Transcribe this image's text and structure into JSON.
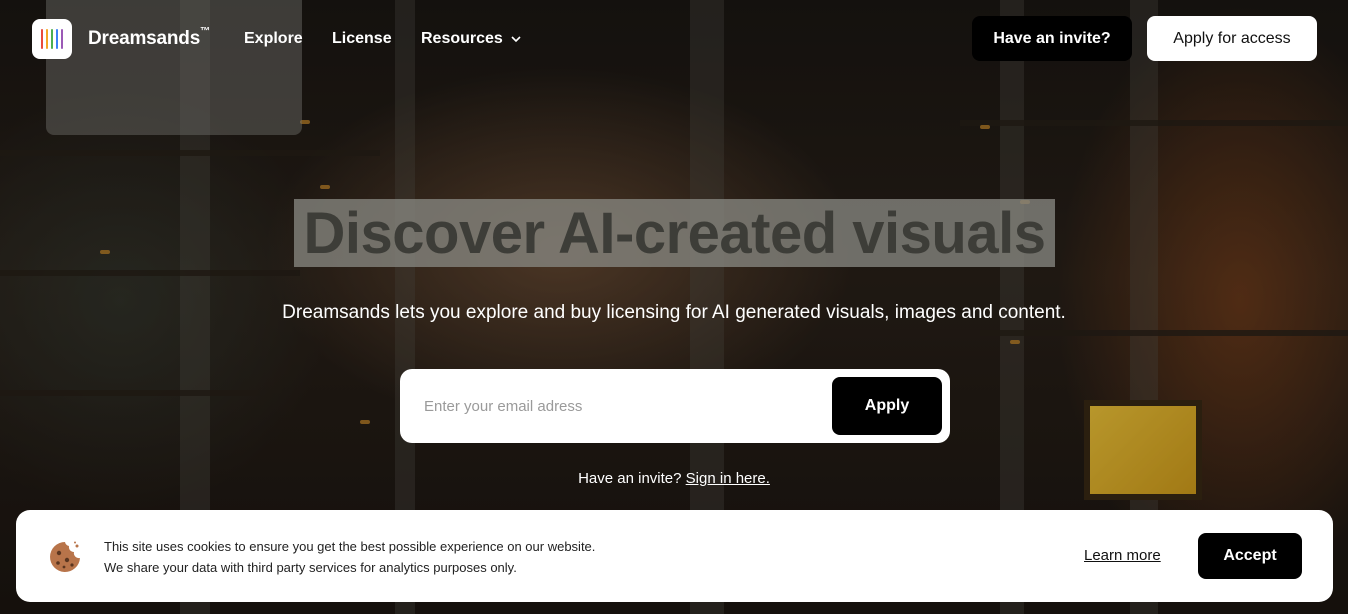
{
  "brand": {
    "name": "Dreamsands",
    "trademark": "™",
    "logo_bar_colors": [
      "#e94b3c",
      "#f5a623",
      "#4caf50",
      "#3b82f6",
      "#9b59b6"
    ]
  },
  "nav": {
    "explore": "Explore",
    "license": "License",
    "resources": "Resources"
  },
  "header_actions": {
    "invite": "Have an invite?",
    "apply": "Apply for access"
  },
  "hero": {
    "title": "Discover AI-created visuals",
    "subtitle": "Dreamsands lets you explore and buy licensing for AI generated visuals, images and content.",
    "email_placeholder": "Enter your email adress",
    "email_value": "",
    "apply_button": "Apply",
    "invite_prompt": "Have an invite?",
    "sign_in_link": "Sign in here."
  },
  "cookie_banner": {
    "icon": "cookie-icon",
    "line1": "This site uses cookies to ensure you get the best possible experience on our website.",
    "line2": "We share your data with third party services for analytics purposes only.",
    "learn_more": "Learn more",
    "accept": "Accept"
  },
  "colors": {
    "primary_button": "#000000",
    "secondary_button": "#ffffff"
  }
}
